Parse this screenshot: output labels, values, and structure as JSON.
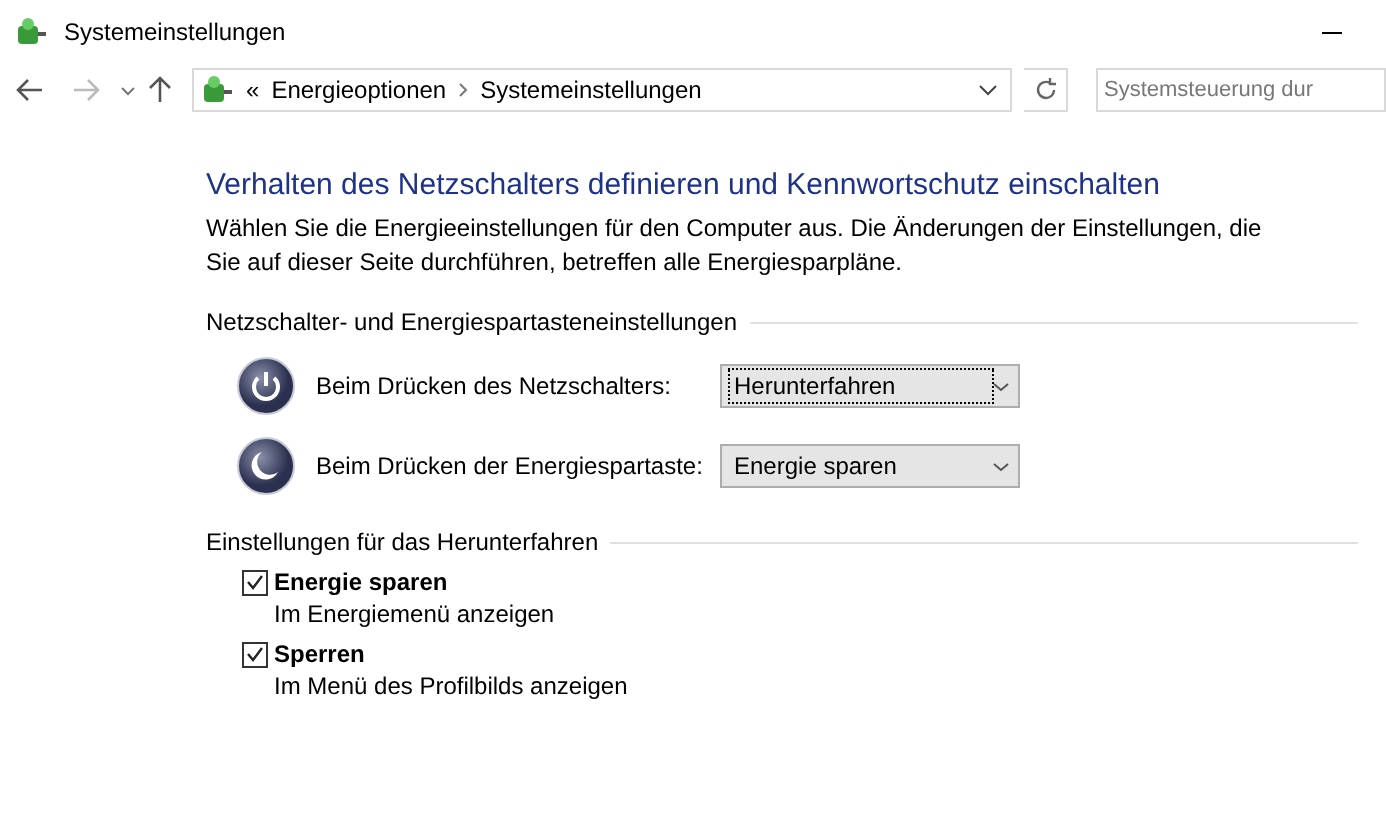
{
  "window": {
    "title": "Systemeinstellungen"
  },
  "address_bar": {
    "overflow": "«",
    "path": [
      "Energieoptionen",
      "Systemeinstellungen"
    ]
  },
  "search": {
    "placeholder": "Systemsteuerung dur"
  },
  "heading": "Verhalten des Netzschalters definieren und Kennwortschutz einschalten",
  "description": "Wählen Sie die Energieeinstellungen für den Computer aus. Die Änderungen der Einstellungen, die Sie auf dieser Seite durchführen, betreffen alle Energiesparpläne.",
  "button_section": {
    "title": "Netzschalter- und Energiespartasteneinstellungen",
    "rows": [
      {
        "kind": "power",
        "label": "Beim Drücken des Netzschalters:",
        "value": "Herunterfahren",
        "focused": true
      },
      {
        "kind": "sleep",
        "label": "Beim Drücken der Energiespartaste:",
        "value": "Energie sparen",
        "focused": false
      }
    ]
  },
  "shutdown_section": {
    "title": "Einstellungen für das Herunterfahren",
    "options": [
      {
        "label": "Energie sparen",
        "description": "Im Energiemenü anzeigen",
        "checked": true
      },
      {
        "label": "Sperren",
        "description": "Im Menü des Profilbilds anzeigen",
        "checked": true
      }
    ]
  }
}
